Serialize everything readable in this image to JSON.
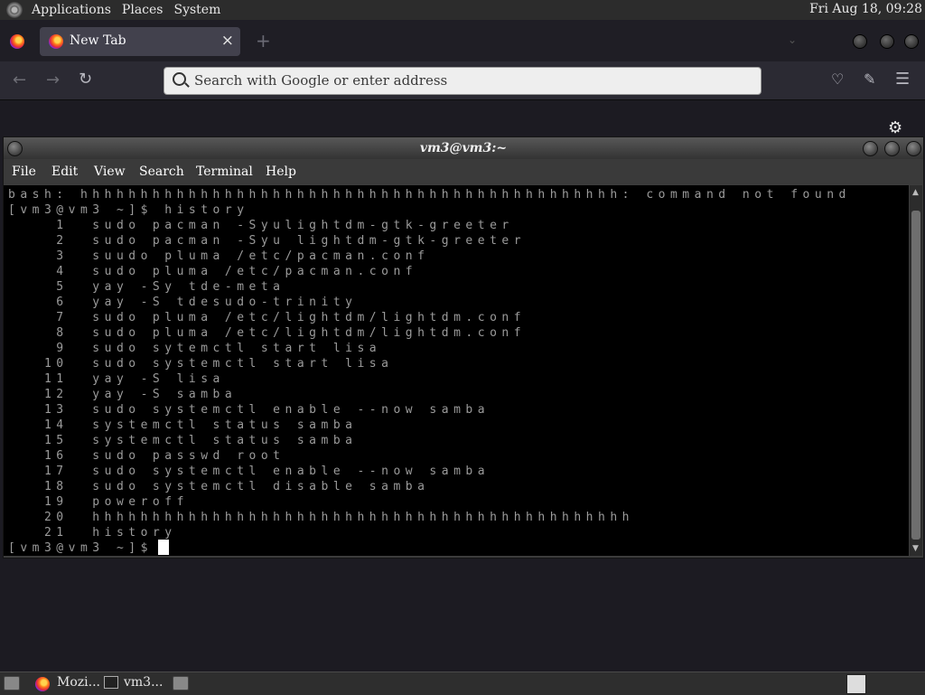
{
  "top_panel": {
    "menus": [
      "Applications",
      "Places",
      "System"
    ],
    "clock": "Fri Aug 18, 09:28"
  },
  "browser": {
    "tab_title": "New Tab",
    "tab_close": "×",
    "new_tab": "+",
    "url_placeholder": "Search with Google or enter address"
  },
  "terminal": {
    "title": "vm3@vm3:~",
    "menu": [
      "File",
      "Edit",
      "View",
      "Search",
      "Terminal",
      "Help"
    ],
    "lines": [
      "bash: hhhhhhhhhhhhhhhhhhhhhhhhhhhhhhhhhhhhhhhhhhhhh: command not found",
      "[vm3@vm3 ~]$ history",
      "    1  sudo pacman -Syulightdm-gtk-greeter",
      "    2  sudo pacman -Syu lightdm-gtk-greeter",
      "    3  suudo pluma /etc/pacman.conf",
      "    4  sudo pluma /etc/pacman.conf",
      "    5  yay -Sy tde-meta",
      "    6  yay -S tdesudo-trinity",
      "    7  sudo pluma /etc/lightdm/lightdm.conf",
      "    8  sudo pluma /etc/lightdm/lightdm.conf",
      "    9  sudo sytemctl start lisa",
      "   10  sudo systemctl start lisa",
      "   11  yay -S lisa",
      "   12  yay -S samba",
      "   13  sudo systemctl enable --now samba",
      "   14  systemctl status samba",
      "   15  systemctl status samba",
      "   16  sudo passwd root",
      "   17  sudo systemctl enable --now samba",
      "   18  sudo systemctl disable samba",
      "   19  poweroff",
      "   20  hhhhhhhhhhhhhhhhhhhhhhhhhhhhhhhhhhhhhhhhhhhhh",
      "   21  history",
      "[vm3@vm3 ~]$ "
    ]
  },
  "taskbar": {
    "firefox_label": "Mozi...",
    "terminal_label": "vm3..."
  }
}
